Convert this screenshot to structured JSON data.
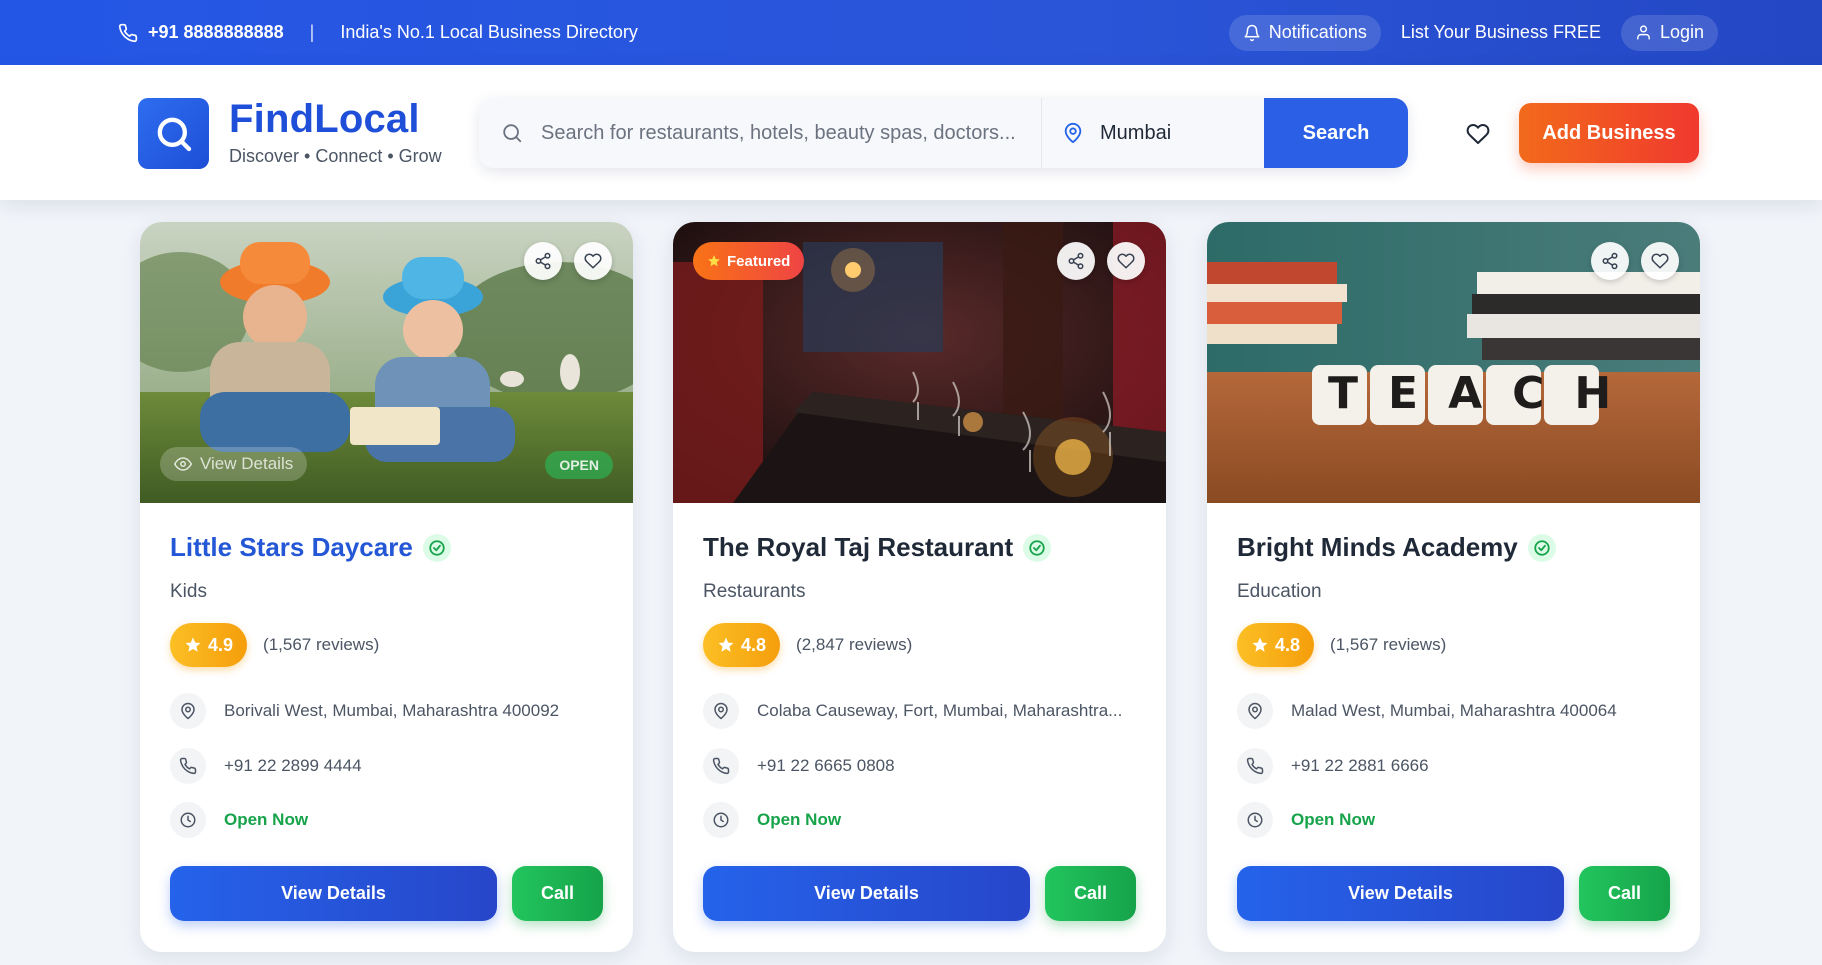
{
  "topbar": {
    "phone": "+91 8888888888",
    "separator": "|",
    "tagline": "India's No.1 Local Business Directory",
    "notifications_label": "Notifications",
    "list_business_label": "List Your Business FREE",
    "login_label": "Login"
  },
  "header": {
    "brand_name": "FindLocal",
    "brand_tagline": "Discover • Connect • Grow",
    "search_placeholder": "Search for restaurants, hotels, beauty spas, doctors...",
    "location_value": "Mumbai",
    "search_button": "Search",
    "add_business_button": "Add Business"
  },
  "listings": [
    {
      "name": "Little Stars Daycare",
      "category": "Kids",
      "rating": "4.9",
      "reviews": "(1,567 reviews)",
      "address": "Borivali West, Mumbai, Maharashtra 400092",
      "phone": "+91 22 2899 4444",
      "status": "Open Now",
      "overlay_view": "View Details",
      "overlay_open": "OPEN",
      "view_button": "View Details",
      "call_button": "Call"
    },
    {
      "name": "The Royal Taj Restaurant",
      "category": "Restaurants",
      "badge": "Featured",
      "rating": "4.8",
      "reviews": "(2,847 reviews)",
      "address": "Colaba Causeway, Fort, Mumbai, Maharashtra...",
      "phone": "+91 22 6665 0808",
      "status": "Open Now",
      "view_button": "View Details",
      "call_button": "Call"
    },
    {
      "name": "Bright Minds Academy",
      "category": "Education",
      "rating": "4.8",
      "reviews": "(1,567 reviews)",
      "address": "Malad West, Mumbai, Maharashtra 400064",
      "phone": "+91 22 2881 6666",
      "status": "Open Now",
      "image_text": "TEACH",
      "view_button": "View Details",
      "call_button": "Call"
    }
  ],
  "colors": {
    "primary": "#2457d6",
    "accent_orange": "#f26a1b",
    "success": "#16a34a",
    "rating": "#f59e0b"
  }
}
